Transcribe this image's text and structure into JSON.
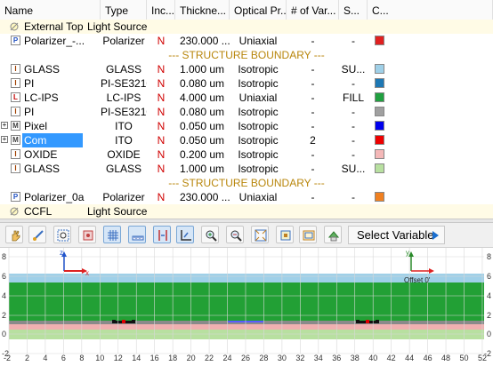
{
  "columns": [
    "Name",
    "Type",
    "Inc...",
    "Thickne...",
    "Optical Pr...",
    "# of Var...",
    "S...",
    "C..."
  ],
  "rows": [
    {
      "kind": "source",
      "icon": "light",
      "name": "External Top",
      "type": "Light Source"
    },
    {
      "kind": "layer",
      "icon": "P",
      "name": "Polarizer_-...",
      "type": "Polarizer",
      "inc": "N",
      "thickness": "230.000 ...",
      "optical": "Uniaxial",
      "vars": "-",
      "s": "-",
      "color": "#e02020"
    },
    {
      "kind": "boundary",
      "text": "--- STRUCTURE BOUNDARY ---"
    },
    {
      "kind": "layer",
      "icon": "I",
      "name": "GLASS",
      "type": "GLASS",
      "inc": "N",
      "thickness": "1.000 um",
      "optical": "Isotropic",
      "vars": "-",
      "s": "SU...",
      "color": "#9fd0e8"
    },
    {
      "kind": "layer",
      "icon": "I",
      "name": "PI",
      "type": "PI-SE3210",
      "inc": "N",
      "thickness": "0.080 um",
      "optical": "Isotropic",
      "vars": "-",
      "s": "-",
      "color": "#1e78b4"
    },
    {
      "kind": "layer",
      "icon": "L",
      "name": "LC-IPS",
      "type": "LC-IPS",
      "inc": "N",
      "thickness": "4.000 um",
      "optical": "Uniaxial",
      "vars": "-",
      "s": "FILL",
      "color": "#20a040"
    },
    {
      "kind": "layer",
      "icon": "I",
      "name": "PI",
      "type": "PI-SE3210",
      "inc": "N",
      "thickness": "0.080 um",
      "optical": "Isotropic",
      "vars": "-",
      "s": "-",
      "color": "#a0a0a0"
    },
    {
      "kind": "layer",
      "icon": "M",
      "expander": "+",
      "name": "Pixel",
      "type": "ITO",
      "inc": "N",
      "thickness": "0.050 um",
      "optical": "Isotropic",
      "vars": "-",
      "s": "-",
      "color": "#0000ee"
    },
    {
      "kind": "layer",
      "icon": "M",
      "expander": "+",
      "name": "Com",
      "type": "ITO",
      "inc": "N",
      "thickness": "0.050 um",
      "optical": "Isotropic",
      "vars": "2",
      "s": "-",
      "color": "#ee0000",
      "selected": true
    },
    {
      "kind": "layer",
      "icon": "I",
      "name": "OXIDE",
      "type": "OXIDE",
      "inc": "N",
      "thickness": "0.200 um",
      "optical": "Isotropic",
      "vars": "-",
      "s": "-",
      "color": "#f4b8b8"
    },
    {
      "kind": "layer",
      "icon": "I",
      "name": "GLASS",
      "type": "GLASS",
      "inc": "N",
      "thickness": "1.000 um",
      "optical": "Isotropic",
      "vars": "-",
      "s": "SU...",
      "color": "#b8e0a0"
    },
    {
      "kind": "boundary",
      "text": "--- STRUCTURE BOUNDARY ---"
    },
    {
      "kind": "layer",
      "icon": "P",
      "name": "Polarizer_0a",
      "type": "Polarizer",
      "inc": "N",
      "thickness": "230.000 ...",
      "optical": "Uniaxial",
      "vars": "-",
      "s": "-",
      "color": "#f08020"
    },
    {
      "kind": "source",
      "icon": "light",
      "name": "CCFL",
      "type": "Light Source"
    }
  ],
  "toolbar": {
    "icons": [
      "hand-icon",
      "zoom-line-icon",
      "zoom-region-icon",
      "center-icon",
      "grid-icon",
      "ruler-icon",
      "vertical-bounds-icon",
      "axes-icon",
      "zoom-in-icon",
      "zoom-out-icon",
      "fit-icon",
      "fit-all-icon",
      "frame-icon",
      "export-icon"
    ],
    "active": [
      4,
      5,
      6,
      7
    ],
    "select_variable": "Select Variable"
  },
  "plot": {
    "x_ticks": [
      "-2",
      "2",
      "4",
      "6",
      "8",
      "10",
      "12",
      "14",
      "16",
      "18",
      "20",
      "22",
      "24",
      "26",
      "28",
      "30",
      "32",
      "34",
      "36",
      "38",
      "40",
      "42",
      "44",
      "46",
      "48",
      "50",
      "52"
    ],
    "y_ticks": [
      "8",
      "6",
      "4",
      "2",
      "0",
      "-2"
    ],
    "axis_x": "x",
    "axis_z": "z",
    "axis_y": "y",
    "offset_label": "Offset 0'"
  }
}
